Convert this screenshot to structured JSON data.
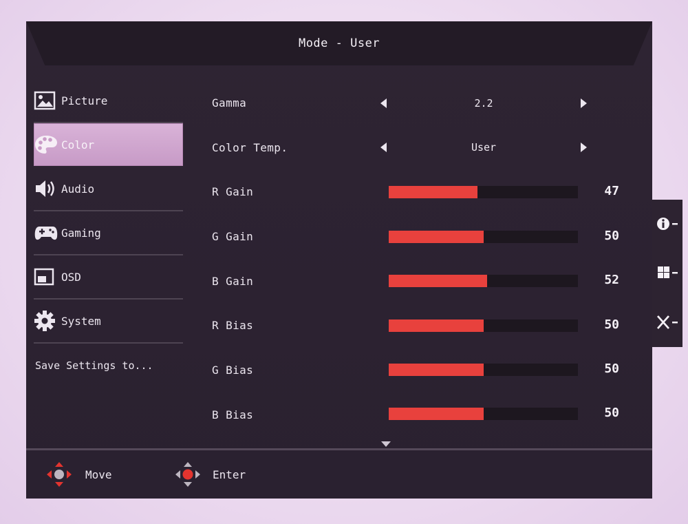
{
  "header": {
    "title": "Mode - User"
  },
  "nav": {
    "items": [
      {
        "label": "Picture",
        "icon": "picture-icon"
      },
      {
        "label": "Color",
        "icon": "palette-icon",
        "active": true
      },
      {
        "label": "Audio",
        "icon": "speaker-icon"
      },
      {
        "label": "Gaming",
        "icon": "gamepad-icon"
      },
      {
        "label": "OSD",
        "icon": "osd-window-icon"
      },
      {
        "label": "System",
        "icon": "gear-icon"
      }
    ],
    "save_settings": "Save Settings to..."
  },
  "settings": {
    "gamma": {
      "label": "Gamma",
      "value": "2.2"
    },
    "color_temp": {
      "label": "Color Temp.",
      "value": "User"
    },
    "sliders": [
      {
        "label": "R Gain",
        "value": "47",
        "level": 47
      },
      {
        "label": "G Gain",
        "value": "50",
        "level": 50
      },
      {
        "label": "B Gain",
        "value": "52",
        "level": 52
      },
      {
        "label": "R Bias",
        "value": "50",
        "level": 50
      },
      {
        "label": "G Bias",
        "value": "50",
        "level": 50
      },
      {
        "label": "B Bias",
        "value": "50",
        "level": 50
      }
    ]
  },
  "footer": {
    "move_label": "Move",
    "enter_label": "Enter"
  },
  "side_panel": {
    "buttons": [
      "info-icon",
      "menu-grid-icon",
      "close-icon"
    ]
  },
  "colors": {
    "accent": "#e8413d",
    "selected": "#d4acd3",
    "panel": "#2c2231"
  }
}
